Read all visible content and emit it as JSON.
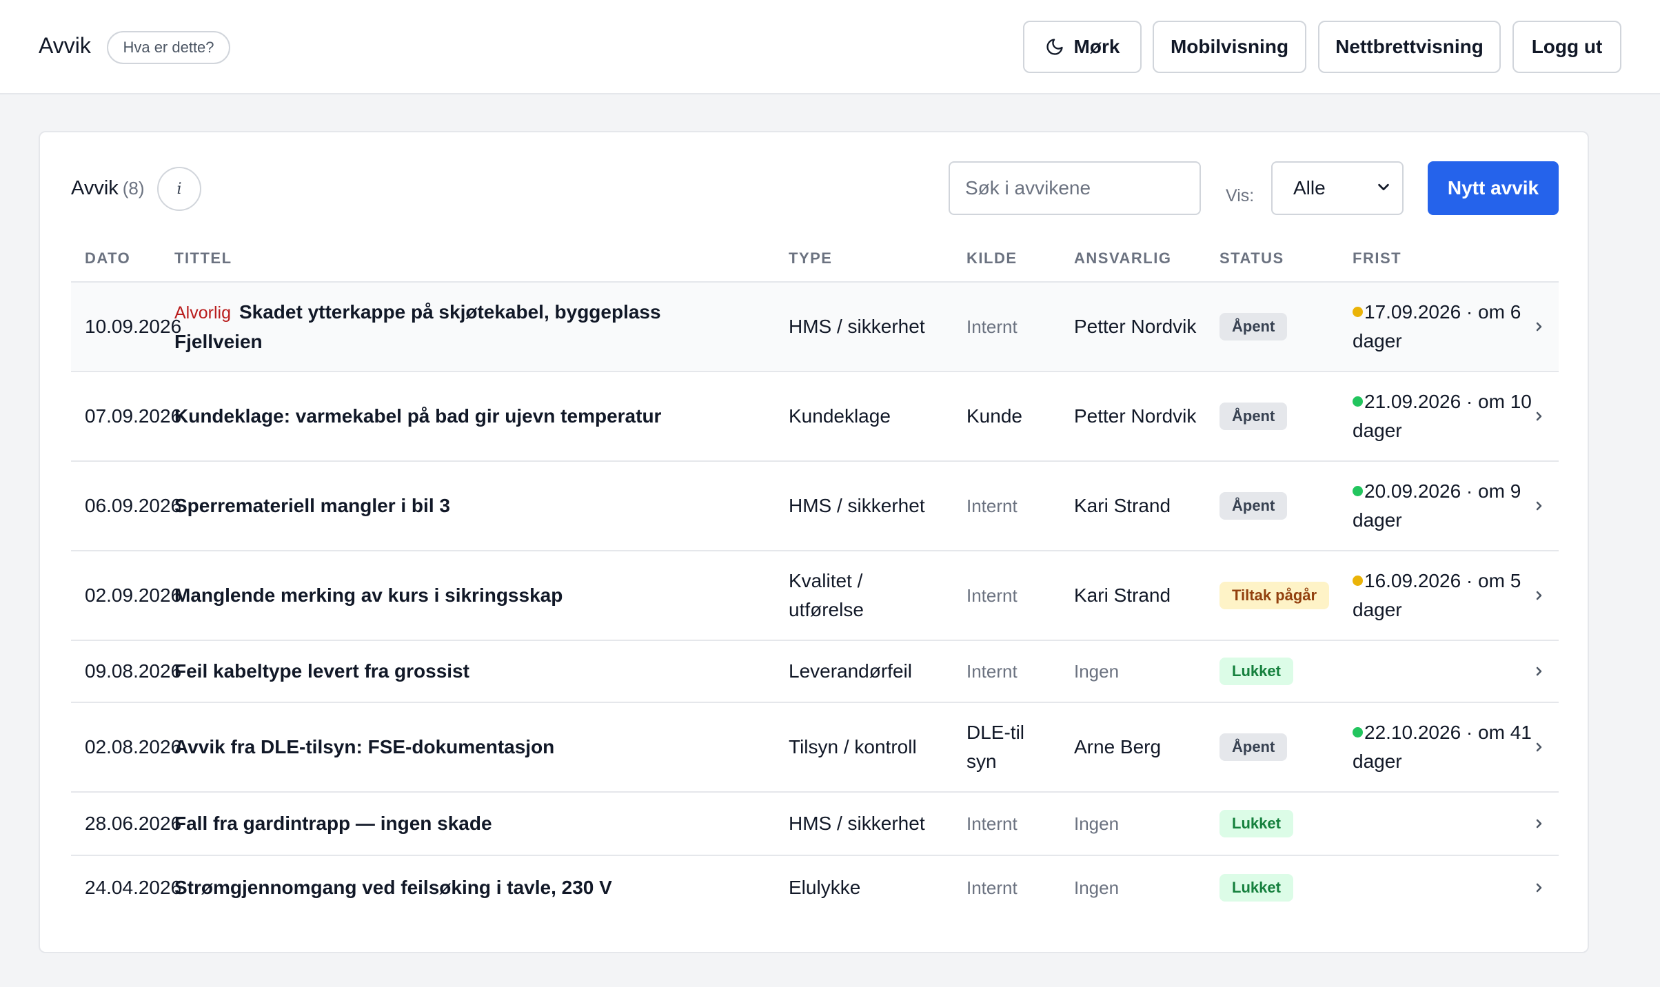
{
  "header": {
    "title": "Avvik",
    "help_label": "Hva er dette?",
    "buttons": {
      "dark": "Mørk",
      "mobile": "Mobilvisning",
      "tablet": "Nettbrettvisning",
      "logout": "Logg ut"
    }
  },
  "card": {
    "title": "Avvik",
    "count": "(8)",
    "info_icon": "i",
    "search_placeholder": "Søk i avvikene",
    "filter_label": "Vis:",
    "filter_value": "Alle",
    "new_button": "Nytt avvik"
  },
  "table": {
    "columns": {
      "date": "DATO",
      "title": "TITTEL",
      "type": "TYPE",
      "source": "KILDE",
      "responsible": "ANSVARLIG",
      "status": "STATUS",
      "deadline": "FRIST"
    },
    "rows": [
      {
        "date": "10.09.2026",
        "severity": "Alvorlig",
        "title": "Skadet ytterkappe på skjøtekabel, byggeplass Fjellveien",
        "type": "HMS / sikkerhet",
        "source": "Internt",
        "responsible": "Petter Nordvik",
        "status": "Åpent",
        "status_kind": "open",
        "deadline": "17.09.2026 · om 6 dager",
        "deadline_color": "#eab308"
      },
      {
        "date": "07.09.2026",
        "severity": "",
        "title": "Kundeklage: varmekabel på bad gir ujevn temperatur",
        "type": "Kundeklage",
        "source": "Kunde",
        "responsible": "Petter Nordvik",
        "status": "Åpent",
        "status_kind": "open",
        "deadline": "21.09.2026 · om 10 dager",
        "deadline_color": "#22c55e"
      },
      {
        "date": "06.09.2026",
        "severity": "",
        "title": "Sperremateriell mangler i bil 3",
        "type": "HMS / sikkerhet",
        "source": "Internt",
        "responsible": "Kari Strand",
        "status": "Åpent",
        "status_kind": "open",
        "deadline": "20.09.2026 · om 9 dager",
        "deadline_color": "#22c55e"
      },
      {
        "date": "02.09.2026",
        "severity": "",
        "title": "Manglende merking av kurs i sikringsskap",
        "type": "Kvalitet / utførelse",
        "source": "Internt",
        "responsible": "Kari Strand",
        "status": "Tiltak pågår",
        "status_kind": "progress",
        "deadline": "16.09.2026 · om 5 dager",
        "deadline_color": "#eab308"
      },
      {
        "date": "09.08.2026",
        "severity": "",
        "title": "Feil kabeltype levert fra grossist",
        "type": "Leverandørfeil",
        "source": "Internt",
        "responsible": "Ingen",
        "status": "Lukket",
        "status_kind": "closed",
        "deadline": "",
        "deadline_color": ""
      },
      {
        "date": "02.08.2026",
        "severity": "",
        "title": "Avvik fra DLE-tilsyn: FSE-dokumentasjon",
        "type": "Tilsyn / kontroll",
        "source": "DLE-tilsyn",
        "responsible": "Arne Berg",
        "status": "Åpent",
        "status_kind": "open",
        "deadline": "22.10.2026 · om 41 dager",
        "deadline_color": "#22c55e"
      },
      {
        "date": "28.06.2026",
        "severity": "",
        "title": "Fall fra gardintrapp — ingen skade",
        "type": "HMS / sikkerhet",
        "source": "Internt",
        "responsible": "Ingen",
        "status": "Lukket",
        "status_kind": "closed",
        "deadline": "",
        "deadline_color": ""
      },
      {
        "date": "24.04.2026",
        "severity": "",
        "title": "Strømgjennomgang ved feilsøking i tavle, 230 V",
        "type": "Elulykke",
        "source": "Internt",
        "responsible": "Ingen",
        "status": "Lukket",
        "status_kind": "closed",
        "deadline": "",
        "deadline_color": ""
      }
    ]
  }
}
